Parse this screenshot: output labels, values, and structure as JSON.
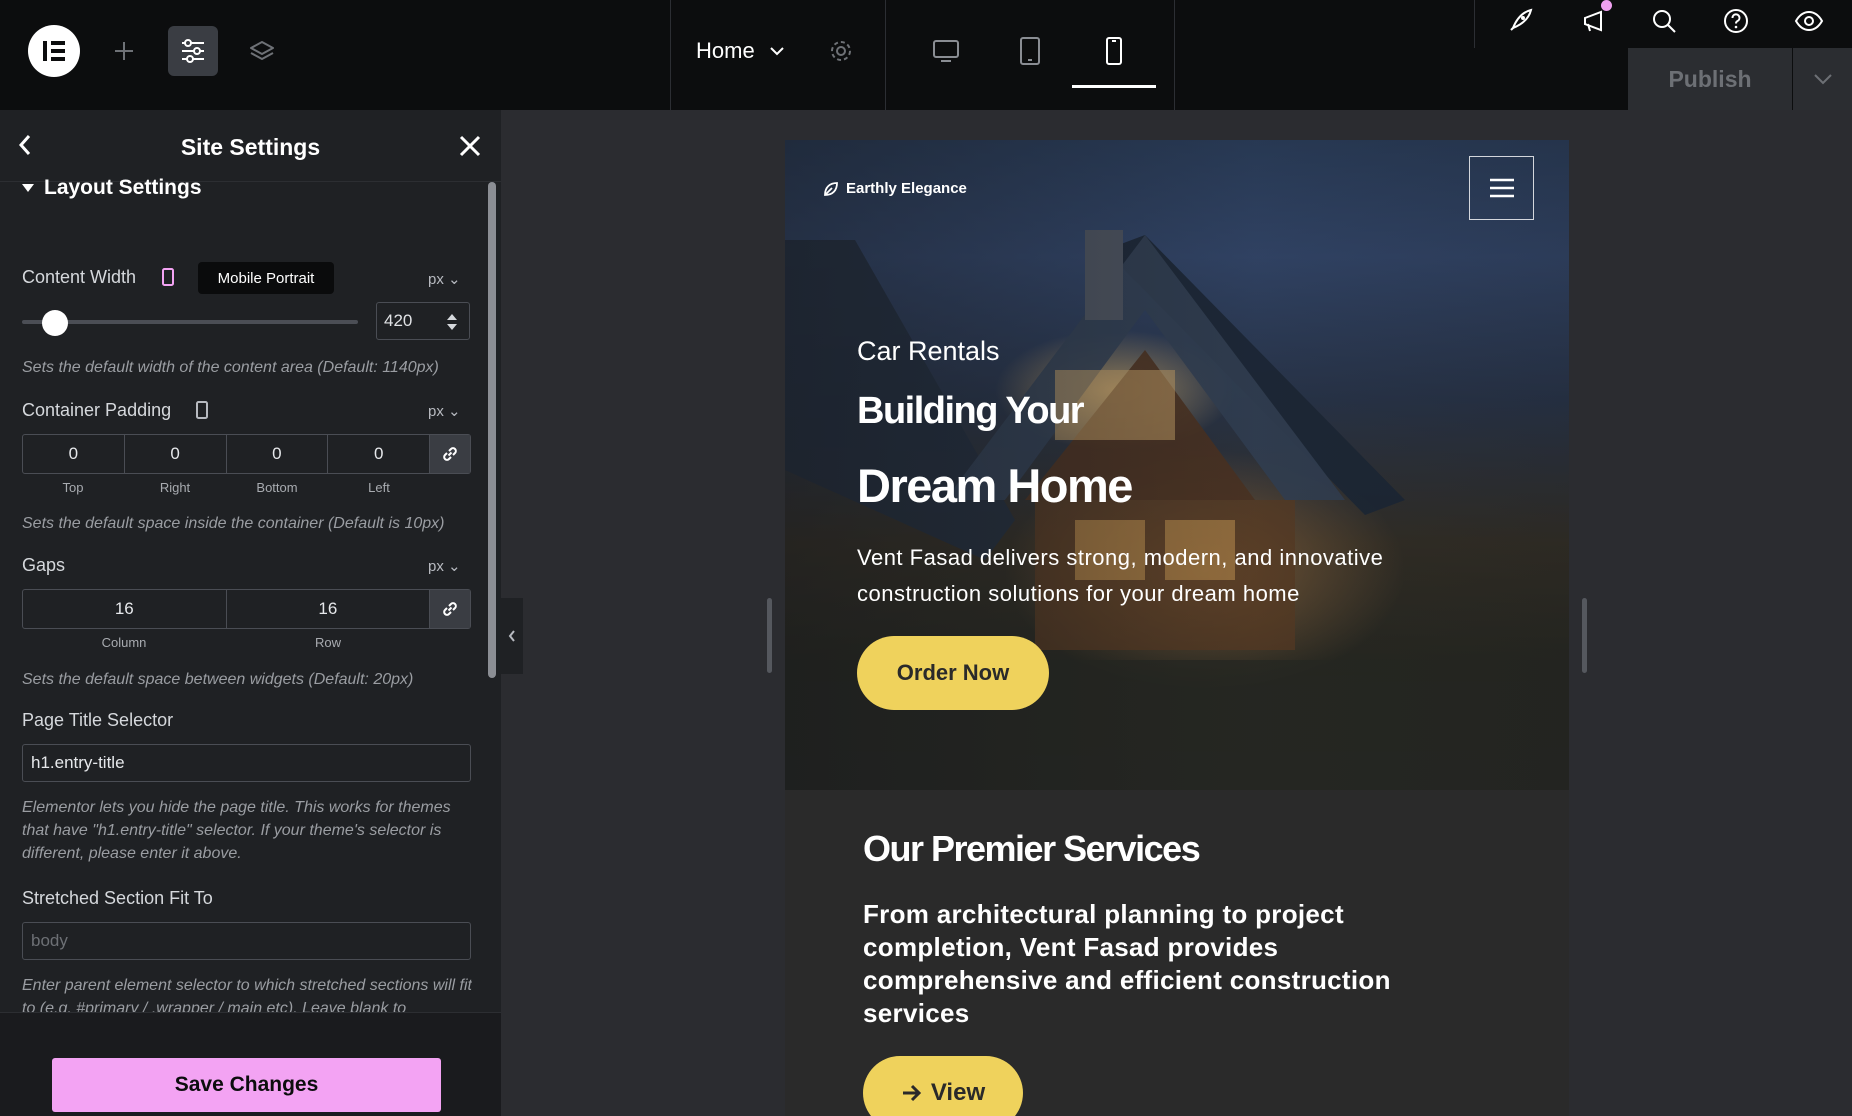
{
  "topbar": {
    "page_selector": "Home",
    "publish_label": "Publish",
    "icons": [
      "elementor-logo-icon",
      "add-icon",
      "site-settings-icon",
      "structure-icon",
      "page-settings-icon",
      "desktop-icon",
      "tablet-icon",
      "mobile-icon",
      "launchpad-icon",
      "whats-new-icon",
      "search-icon",
      "help-icon",
      "preview-icon",
      "chevron-down-icon"
    ],
    "active_device": "mobile"
  },
  "panel": {
    "title": "Site Settings",
    "section_title": "Layout Settings",
    "content_width": {
      "label": "Content Width",
      "tooltip": "Mobile Portrait",
      "unit": "px",
      "value": "420",
      "hint": "Sets the default width of the content area (Default: 1140px)"
    },
    "container_padding": {
      "label": "Container Padding",
      "unit": "px",
      "values": [
        "0",
        "0",
        "0",
        "0"
      ],
      "sides": [
        "Top",
        "Right",
        "Bottom",
        "Left"
      ],
      "hint": "Sets the default space inside the container (Default is 10px)"
    },
    "gaps": {
      "label": "Gaps",
      "unit": "px",
      "column": "16",
      "row": "16",
      "column_label": "Column",
      "row_label": "Row",
      "hint": "Sets the default space between widgets (Default: 20px)"
    },
    "page_title_selector": {
      "label": "Page Title Selector",
      "value": "h1.entry-title",
      "hint": "Elementor lets you hide the page title. This works for themes that have \"h1.entry-title\" selector. If your theme's selector is different, please enter it above."
    },
    "stretched_section": {
      "label": "Stretched Section Fit To",
      "placeholder": "body",
      "hint": "Enter parent element selector to which stretched sections will fit to (e.g. #primary / .wrapper / main etc). Leave blank to"
    },
    "save_label": "Save Changes"
  },
  "preview": {
    "brand": "Earthly Elegance",
    "kicker": "Car Rentals",
    "heading_line1": "Building Your",
    "heading_line2": "Dream Home",
    "description": "Vent Fasad delivers strong, modern, and innovative construction solutions for your dream home",
    "order_button": "Order Now",
    "services_title": "Our Premier Services",
    "services_desc": "From architectural planning to project completion, Vent Fasad provides comprehensive and efficient construction services",
    "view_button": "View"
  },
  "colors": {
    "topbar_bg": "#0c0d0e",
    "panel_bg": "#1f2124",
    "accent_pink": "#f3a3f3",
    "button_yellow": "#efd25c"
  }
}
